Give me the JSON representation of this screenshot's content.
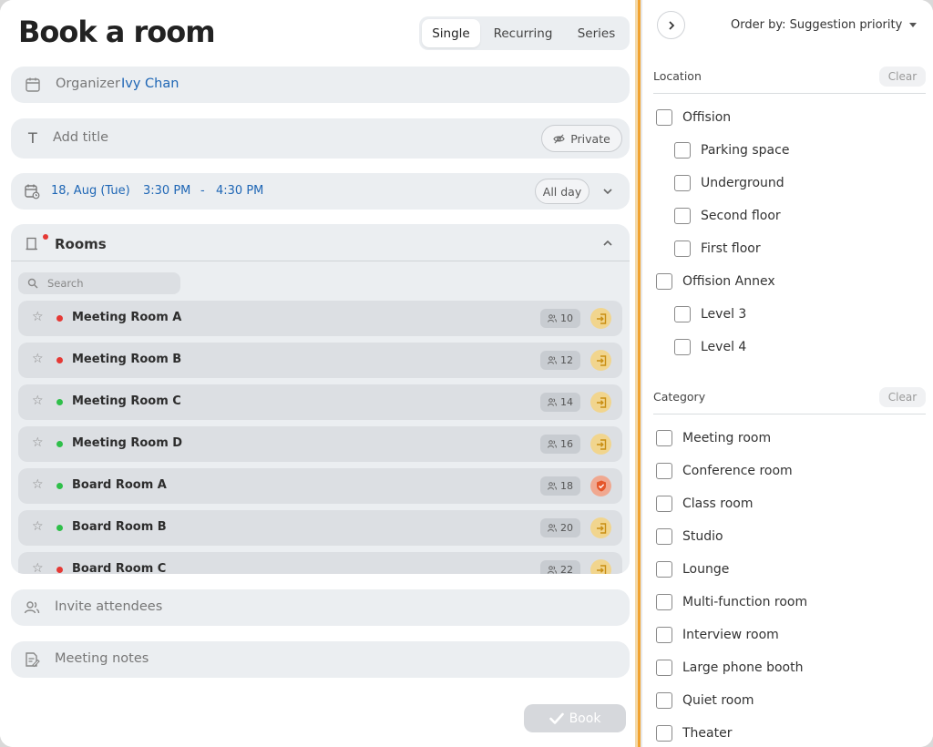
{
  "header": {
    "title": "Book a room",
    "tabs": [
      {
        "label": "Single",
        "active": true
      },
      {
        "label": "Recurring",
        "active": false
      },
      {
        "label": "Series",
        "active": false
      }
    ]
  },
  "organizer": {
    "label": "Organizer",
    "name": "Ivy Chan"
  },
  "title_field": {
    "placeholder": "Add title",
    "private_label": "Private"
  },
  "datetime": {
    "date": "18, Aug (Tue)",
    "start": "3:30 PM",
    "separator": "-",
    "end": "4:30 PM",
    "allday_label": "All day"
  },
  "rooms": {
    "title": "Rooms",
    "search_placeholder": "Search",
    "items": [
      {
        "name": "Meeting Room A",
        "status": "busy",
        "capacity": "10",
        "action": "check-in"
      },
      {
        "name": "Meeting Room B",
        "status": "busy",
        "capacity": "12",
        "action": "check-in"
      },
      {
        "name": "Meeting Room C",
        "status": "available",
        "capacity": "14",
        "action": "check-in"
      },
      {
        "name": "Meeting Room D",
        "status": "available",
        "capacity": "16",
        "action": "check-in"
      },
      {
        "name": "Board Room A",
        "status": "available",
        "capacity": "18",
        "action": "restricted"
      },
      {
        "name": "Board Room B",
        "status": "available",
        "capacity": "20",
        "action": "check-in"
      },
      {
        "name": "Board Room C",
        "status": "busy",
        "capacity": "22",
        "action": "check-in"
      }
    ]
  },
  "attendees": {
    "placeholder": "Invite attendees"
  },
  "notes": {
    "placeholder": "Meeting notes"
  },
  "book": {
    "label": "Book"
  },
  "filters": {
    "order_by": "Order by: Suggestion priority",
    "location": {
      "title": "Location",
      "clear": "Clear",
      "options": [
        {
          "label": "Offision",
          "level": 0
        },
        {
          "label": "Parking space",
          "level": 1
        },
        {
          "label": "Underground",
          "level": 1
        },
        {
          "label": "Second floor",
          "level": 1
        },
        {
          "label": "First floor",
          "level": 1
        },
        {
          "label": "Offision Annex",
          "level": 0
        },
        {
          "label": "Level 3",
          "level": 1
        },
        {
          "label": "Level 4",
          "level": 1
        }
      ]
    },
    "category": {
      "title": "Category",
      "clear": "Clear",
      "options": [
        {
          "label": "Meeting room"
        },
        {
          "label": "Conference room"
        },
        {
          "label": "Class room"
        },
        {
          "label": "Studio"
        },
        {
          "label": "Lounge"
        },
        {
          "label": "Multi-function room"
        },
        {
          "label": "Interview room"
        },
        {
          "label": "Large phone booth"
        },
        {
          "label": "Quiet room"
        },
        {
          "label": "Theater"
        }
      ]
    }
  },
  "colors": {
    "accent": "#1e66b5",
    "busy": "#e53935",
    "available": "#2fbf4a",
    "divider": "#f2a330"
  }
}
